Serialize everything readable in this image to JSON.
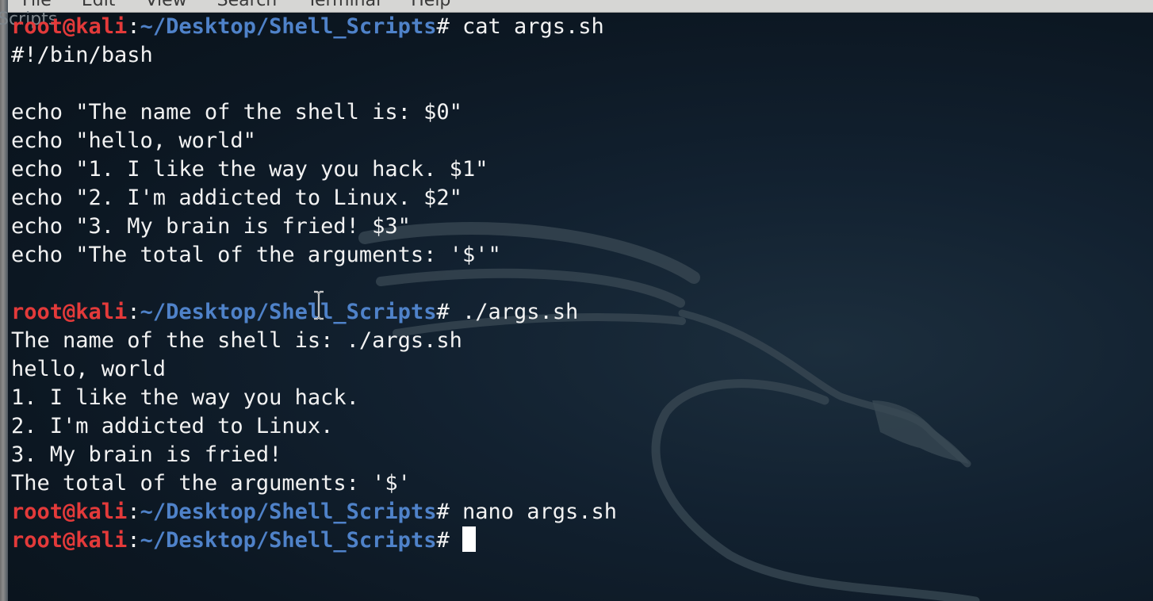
{
  "menubar": {
    "items": [
      "File",
      "Edit",
      "View",
      "Search",
      "Terminal",
      "Help"
    ]
  },
  "side_window": {
    "label": "Scripts"
  },
  "prompt": {
    "user_host": "root@kali",
    "colon": ":",
    "path": "~/Desktop/Shell_Scripts",
    "hash": "#"
  },
  "terminal": {
    "lines": [
      {
        "type": "prompt",
        "command": " cat args.sh"
      },
      {
        "type": "output",
        "text": "#!/bin/bash"
      },
      {
        "type": "output",
        "text": ""
      },
      {
        "type": "output",
        "text": "echo \"The name of the shell is: $0\""
      },
      {
        "type": "output",
        "text": "echo \"hello, world\""
      },
      {
        "type": "output",
        "text": "echo \"1. I like the way you hack. $1\""
      },
      {
        "type": "output",
        "text": "echo \"2. I'm addicted to Linux. $2\""
      },
      {
        "type": "output",
        "text": "echo \"3. My brain is fried! $3\""
      },
      {
        "type": "output",
        "text": "echo \"The total of the arguments: '$'\""
      },
      {
        "type": "output",
        "text": ""
      },
      {
        "type": "prompt",
        "command": " ./args.sh"
      },
      {
        "type": "output",
        "text": "The name of the shell is: ./args.sh"
      },
      {
        "type": "output",
        "text": "hello, world"
      },
      {
        "type": "output",
        "text": "1. I like the way you hack."
      },
      {
        "type": "output",
        "text": "2. I'm addicted to Linux."
      },
      {
        "type": "output",
        "text": "3. My brain is fried!"
      },
      {
        "type": "output",
        "text": "The total of the arguments: '$'"
      },
      {
        "type": "prompt",
        "command": " nano args.sh"
      },
      {
        "type": "prompt",
        "command": " ",
        "cursor": true
      }
    ]
  },
  "colors": {
    "prompt_user": "#e33a3a",
    "prompt_path": "#4f82c9",
    "text": "#f2f2f2",
    "background": "#0c1722"
  }
}
